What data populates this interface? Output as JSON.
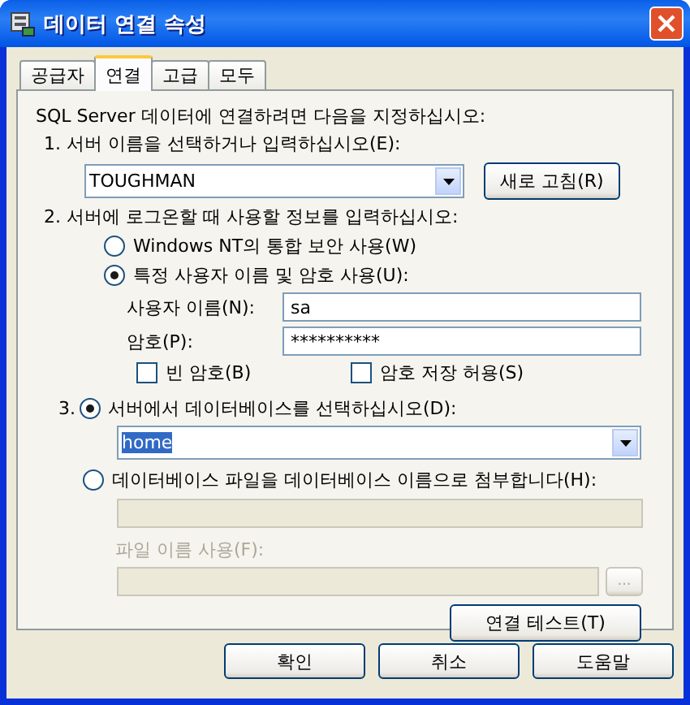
{
  "window": {
    "title": "데이터 연결 속성"
  },
  "tabs": [
    {
      "label": "공급자",
      "selected": false
    },
    {
      "label": "연결",
      "selected": true
    },
    {
      "label": "고급",
      "selected": false
    },
    {
      "label": "모두",
      "selected": false
    }
  ],
  "intro": "SQL Server 데이터에 연결하려면 다음을 지정하십시오:",
  "step1": {
    "label": "1. 서버 이름을 선택하거나 입력하십시오(E):",
    "server": {
      "value": "TOUGHMAN"
    },
    "refresh_button": "새로 고침(R)"
  },
  "step2": {
    "label": "2. 서버에 로그온할 때 사용할 정보를 입력하십시오:",
    "auth_options": [
      {
        "label": "Windows NT의 통합 보안 사용(W)",
        "selected": false
      },
      {
        "label": "특정 사용자 이름 및 암호 사용(U):",
        "selected": true
      }
    ],
    "username": {
      "label": "사용자 이름(N):",
      "value": "sa"
    },
    "password": {
      "label": "암호(P):",
      "value": "**********"
    },
    "checkboxes": [
      {
        "label": "빈 암호(B)",
        "checked": false
      },
      {
        "label": "암호 저장 허용(S)",
        "checked": false
      }
    ]
  },
  "step3": {
    "number": "3.",
    "options": [
      {
        "label": "서버에서 데이터베이스를 선택하십시오(D):",
        "selected": true
      },
      {
        "label": "데이터베이스 파일을 데이터베이스 이름으로 첨부합니다(H):",
        "selected": false
      }
    ],
    "database": {
      "value": "home",
      "text_selected": true
    },
    "attach_field": {
      "disabled": true
    },
    "file_name": {
      "label": "파일 이름 사용(F):",
      "disabled": true
    },
    "browse_button": "...",
    "test_button": "연결 테스트(T)"
  },
  "buttons": [
    "확인",
    "취소",
    "도움말"
  ]
}
